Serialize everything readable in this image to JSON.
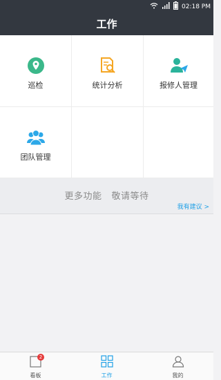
{
  "status_bar": {
    "time": "02:18 PM"
  },
  "header": {
    "title": "工作"
  },
  "grid": {
    "items": [
      {
        "label": "巡检",
        "icon": "location-pin-icon",
        "color": "#3bb88a"
      },
      {
        "label": "统计分析",
        "icon": "document-search-icon",
        "color": "#f5a623"
      },
      {
        "label": "报修人管理",
        "icon": "user-send-icon",
        "color": "#2bb39b"
      },
      {
        "label": "团队管理",
        "icon": "team-icon",
        "color": "#2ca8e8"
      }
    ]
  },
  "more": {
    "message": "更多功能   敬请等待",
    "suggest_link": "我有建议 >"
  },
  "bottom_nav": {
    "tabs": [
      {
        "label": "看板",
        "icon": "board-icon",
        "badge": "2"
      },
      {
        "label": "工作",
        "icon": "grid-icon",
        "active": true
      },
      {
        "label": "我的",
        "icon": "person-icon"
      }
    ]
  },
  "colors": {
    "accent": "#1fa0e6",
    "header_bg": "#333840",
    "badge": "#e53b3b"
  }
}
